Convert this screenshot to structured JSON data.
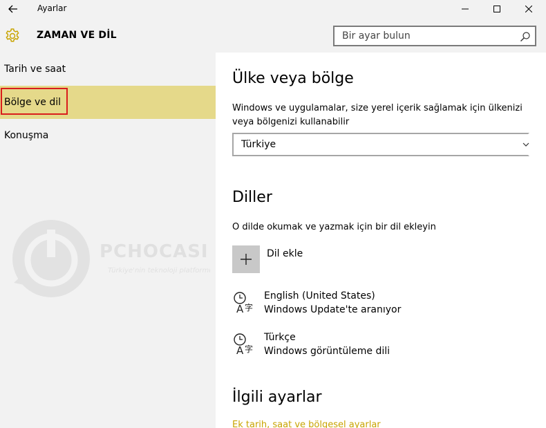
{
  "window": {
    "title": "Ayarlar",
    "icons": {
      "back": "back-arrow-icon",
      "minimize": "minimize-icon",
      "maximize": "maximize-icon",
      "close": "close-icon"
    }
  },
  "header": {
    "title": "ZAMAN VE DİL",
    "search_placeholder": "Bir ayar bulun"
  },
  "sidebar": {
    "items": [
      {
        "label": "Tarih ve saat"
      },
      {
        "label": "Bölge ve dil",
        "selected": true
      },
      {
        "label": "Konuşma"
      }
    ]
  },
  "region": {
    "heading": "Ülke veya bölge",
    "description": "Windows ve uygulamalar, size yerel içerik sağlamak için ülkenizi veya bölgenizi kullanabilir",
    "selected_country": "Türkiye"
  },
  "languages": {
    "heading": "Diller",
    "description": "O dilde okumak ve yazmak için bir dil ekleyin",
    "add_label": "Dil ekle",
    "items": [
      {
        "name": "English (United States)",
        "status": "Windows Update'te aranıyor"
      },
      {
        "name": "Türkçe",
        "status": "Windows görüntüleme dili"
      }
    ]
  },
  "related": {
    "heading": "İlgili ayarlar",
    "link": "Ek tarih, saat ve bölgesel ayarlar"
  },
  "colors": {
    "accent": "#c8a400",
    "selected_bg": "#e5d98a",
    "highlight_border": "#d91c1c"
  }
}
